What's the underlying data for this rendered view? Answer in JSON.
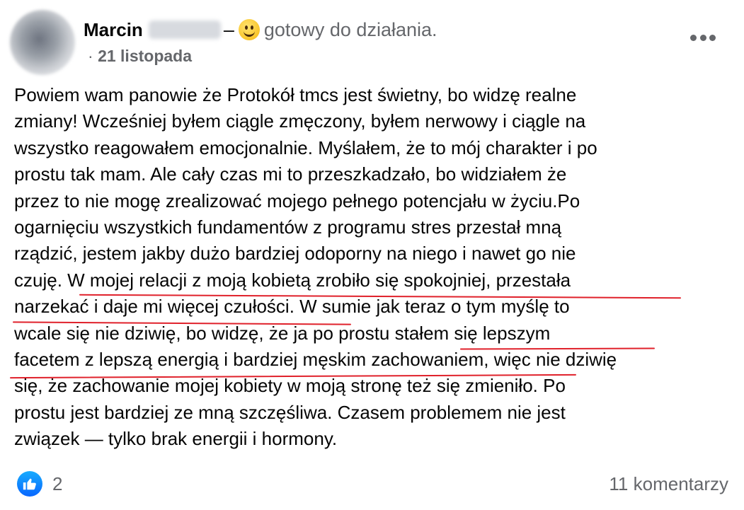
{
  "post": {
    "author": "Marcin",
    "feeling_separator": "–",
    "feeling_text": "gotowy do działania.",
    "meta_prefix": "·",
    "date": "21 listopada",
    "body_lines": [
      "Powiem wam panowie że Protokół tmcs jest świetny, bo widzę realne",
      "zmiany! Wcześniej byłem ciągle zmęczony, byłem nerwowy i ciągle na",
      "wszystko reagowałem emocjonalnie. Myślałem, że to mój charakter i po",
      "prostu tak mam. Ale cały czas mi to przeszkadzało, bo widziałem że",
      "przez to nie mogę zrealizować mojego pełnego potencjału w życiu.Po",
      "ogarnięciu wszystkich fundamentów z programu stres przestał mną",
      "rządzić, jestem jakby dużo bardziej odoporny na niego i nawet go nie",
      "czuję. W mojej relacji z moją kobietą zrobiło się spokojniej, przestała",
      "narzekać i daje mi więcej czułości. W sumie jak teraz o tym myślę to",
      "wcale się nie dziwię, bo widzę, że ja po prostu stałem się lepszym",
      "facetem z lepszą energią i bardziej męskim zachowaniem, więc nie dziwię",
      "się, że zachowanie mojej kobiety w moją stronę też się zmieniło. Po",
      "prostu jest bardziej ze mną szczęśliwa. Czasem problemem nie jest",
      "związek — tylko brak energii i hormony."
    ],
    "highlight_color": "#e0212b"
  },
  "footer": {
    "reaction_icon": "thumbs-up-icon",
    "reaction_count": "2",
    "comments": "11 komentarzy"
  },
  "colors": {
    "secondary_text": "#65676b",
    "like_blue": "#0866ff"
  }
}
